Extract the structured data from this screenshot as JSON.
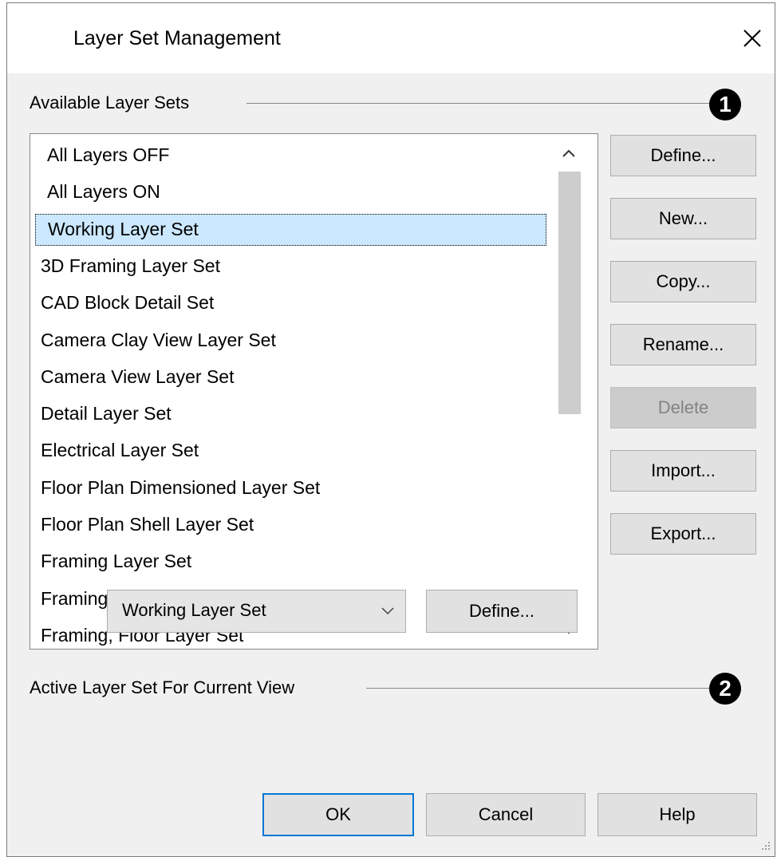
{
  "window": {
    "title": "Layer Set Management"
  },
  "available_group": {
    "label": "Available Layer Sets",
    "callout": "1"
  },
  "layer_sets": [
    {
      "label": "All Layers OFF",
      "indent": true,
      "selected": false
    },
    {
      "label": "All Layers ON",
      "indent": true,
      "selected": false
    },
    {
      "label": "Working Layer Set",
      "indent": true,
      "selected": true
    },
    {
      "label": "3D Framing Layer Set",
      "indent": false,
      "selected": false
    },
    {
      "label": "CAD Block Detail Set",
      "indent": false,
      "selected": false
    },
    {
      "label": "Camera Clay View Layer Set",
      "indent": false,
      "selected": false
    },
    {
      "label": "Camera View Layer Set",
      "indent": false,
      "selected": false
    },
    {
      "label": "Detail Layer Set",
      "indent": false,
      "selected": false
    },
    {
      "label": "Electrical Layer Set",
      "indent": false,
      "selected": false
    },
    {
      "label": "Floor Plan Dimensioned Layer Set",
      "indent": false,
      "selected": false
    },
    {
      "label": "Floor Plan Shell Layer Set",
      "indent": false,
      "selected": false
    },
    {
      "label": "Framing Layer Set",
      "indent": false,
      "selected": false
    },
    {
      "label": "Framing, Ceiling Layer Set",
      "indent": false,
      "selected": false
    },
    {
      "label": "Framing, Floor Layer Set",
      "indent": false,
      "selected": false
    }
  ],
  "side_buttons": [
    {
      "name": "define-button",
      "label": "Define...",
      "disabled": false
    },
    {
      "name": "new-button",
      "label": "New...",
      "disabled": false
    },
    {
      "name": "copy-button",
      "label": "Copy...",
      "disabled": false
    },
    {
      "name": "rename-button",
      "label": "Rename...",
      "disabled": false
    },
    {
      "name": "delete-button",
      "label": "Delete",
      "disabled": true
    },
    {
      "name": "import-button",
      "label": "Import...",
      "disabled": false
    },
    {
      "name": "export-button",
      "label": "Export...",
      "disabled": false
    }
  ],
  "active_group": {
    "label": "Active Layer Set For Current View",
    "callout": "2",
    "selected_value": "Working Layer Set",
    "define_label": "Define..."
  },
  "footer": {
    "ok_label": "OK",
    "cancel_label": "Cancel",
    "help_label": "Help"
  },
  "icons": {
    "close": "close-icon",
    "scroll_up": "chevron-up-icon",
    "scroll_down": "chevron-down-icon",
    "dropdown": "chevron-down-icon",
    "grip": "resize-grip-icon"
  },
  "colors": {
    "dialog_bg": "#f0f0f0",
    "selection_bg": "#cce8ff",
    "default_button_border": "#0078d7",
    "disabled_text": "#838383"
  }
}
